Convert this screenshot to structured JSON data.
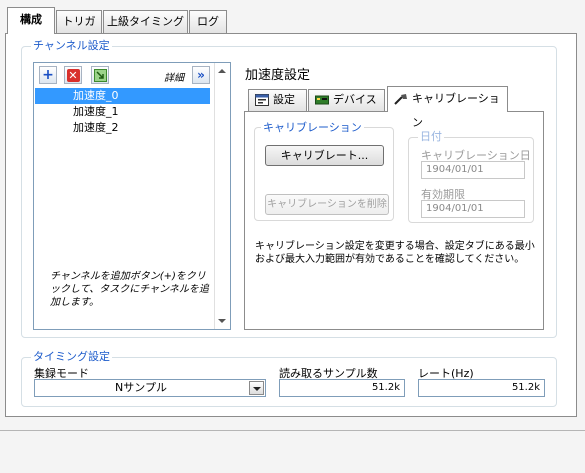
{
  "tabs": [
    "構成",
    "トリガ",
    "上級タイミング",
    "ログ"
  ],
  "channel_settings": {
    "title": "チャンネル設定",
    "details_label": "詳細",
    "channels": [
      "加速度_0",
      "加速度_1",
      "加速度_2"
    ],
    "hint": "チャンネルを追加ボタン(+)をクリックして、タスクにチャンネルを追加します。"
  },
  "channel_panel": {
    "title": "加速度設定",
    "subtabs": [
      "設定",
      "デバイス",
      "キャリブレーション"
    ],
    "calibration": {
      "group_title": "キャリブレーション",
      "calibrate_button": "キャリブレート...",
      "delete_button": "キャリブレーションを削除"
    },
    "date": {
      "group_title": "日付",
      "cal_date_label": "キャリブレーション日",
      "cal_date_value": "1904/01/01",
      "expiry_label": "有効期限",
      "expiry_value": "1904/01/01"
    },
    "note": "キャリブレーション設定を変更する場合、設定タブにある最小および最大入力範囲が有効であることを確認してください。"
  },
  "timing": {
    "title": "タイミング設定",
    "mode_label": "集録モード",
    "mode_value": "Nサンプル",
    "samples_label": "読み取るサンプル数",
    "samples_value": "51.2k",
    "rate_label": "レート(Hz)",
    "rate_value": "51.2k"
  },
  "colors": {
    "accent": "#1e5ccb",
    "selection": "#3399ff"
  }
}
